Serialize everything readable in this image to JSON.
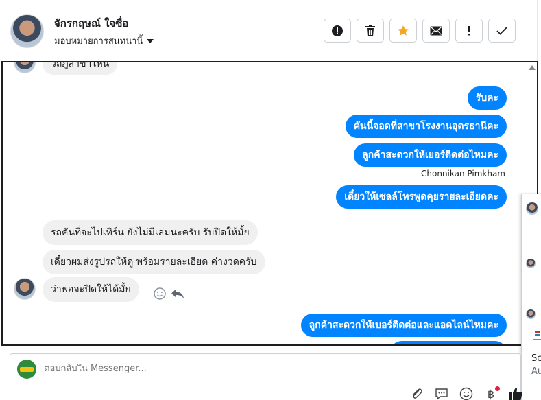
{
  "header": {
    "contact_name": "จักรกฤษณ์ ใจซื่อ",
    "assign_label": "มอบหมายการสนทนานี้",
    "actions": [
      {
        "icon": "exclamation-circle-icon"
      },
      {
        "icon": "trash-icon"
      },
      {
        "icon": "star-icon",
        "color": "#f5a623"
      },
      {
        "icon": "envelope-icon"
      },
      {
        "icon": "exclamation-icon"
      },
      {
        "icon": "check-icon"
      }
    ]
  },
  "chat": {
    "partial_top_message": "วิถีภูสาขาไหน",
    "sender_label": "Chonnikan Pimkham",
    "outgoing": [
      "รับคะ",
      "คันนี้จอดที่สาขาโรงงานอุดรธานีคะ",
      "ลูกค้าสะดวกให้เยอร์ติดต่อไหมคะ",
      "เดี๋ยวให้เซลล์โทรพูดคุยรายละเอียดคะ",
      "ลูกค้าสะดวกให้เบอร์ติดต่อและแอดไลน์ไหมคะ"
    ],
    "incoming": [
      "รถคันที่จะไปเทิร์น  ยังไม่มีเล่มนะครับ   รับปิดให้มั้ย",
      "เดี๋ยวผมส่งรูปรถให้ดู    พร้อมรายละเอียด  ค่างวดครับ",
      "ว่าพอจะปิดให้ได้มั้ย"
    ]
  },
  "side_panel": {
    "text_1": "Sc",
    "text_2": "Au"
  },
  "composer": {
    "placeholder": "ตอบกลับใน Messenger..."
  },
  "colors": {
    "outgoing_bubble": "#0084ff",
    "incoming_bubble": "#f0f0f0",
    "star": "#f5a623"
  }
}
